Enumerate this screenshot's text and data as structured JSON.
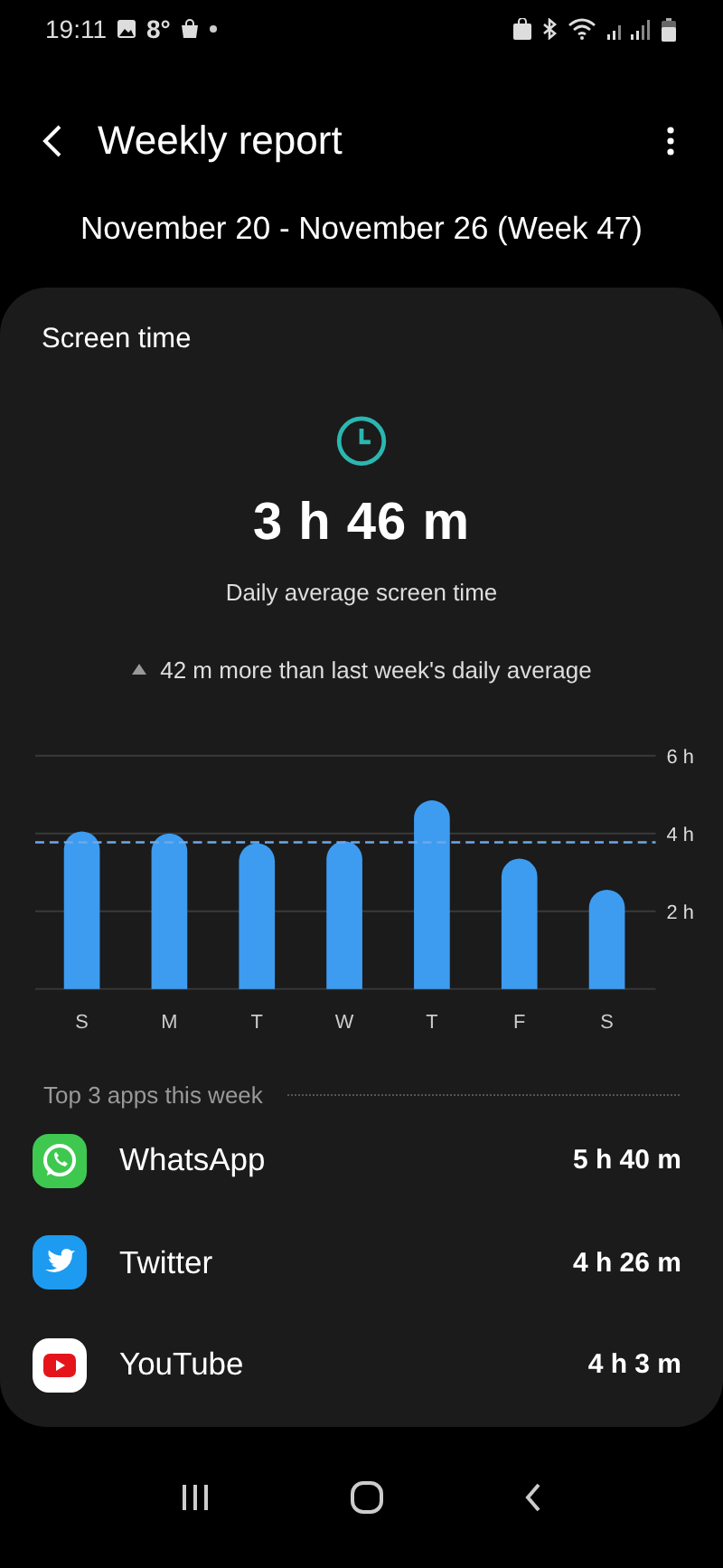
{
  "status_bar": {
    "time": "19:11",
    "temperature": "8°"
  },
  "header": {
    "title": "Weekly report"
  },
  "date_range": "November 20 - November 26 (Week 47)",
  "screen_time": {
    "title": "Screen time",
    "total": "3 h 46 m",
    "caption": "Daily average screen time",
    "comparison": "42 m more than last week's daily average",
    "chart_data": {
      "type": "bar",
      "categories": [
        "S",
        "M",
        "T",
        "W",
        "T",
        "F",
        "S"
      ],
      "values": [
        4.05,
        4.0,
        3.75,
        3.8,
        4.85,
        3.35,
        2.55
      ],
      "ylim": [
        0,
        6
      ],
      "yticks": [
        {
          "value": 2,
          "label": "2 h"
        },
        {
          "value": 4,
          "label": "4 h"
        },
        {
          "value": 6,
          "label": "6 h"
        }
      ],
      "ref_lines": [
        {
          "axis": "y",
          "value": 3.77
        }
      ]
    }
  },
  "top_apps": {
    "title": "Top 3 apps this week",
    "apps": [
      {
        "name": "WhatsApp",
        "time": "5 h 40 m",
        "kind": "chat"
      },
      {
        "name": "Twitter",
        "time": "4 h 26 m",
        "kind": "bird"
      },
      {
        "name": "YouTube",
        "time": "4 h 3 m",
        "kind": "play"
      }
    ]
  }
}
